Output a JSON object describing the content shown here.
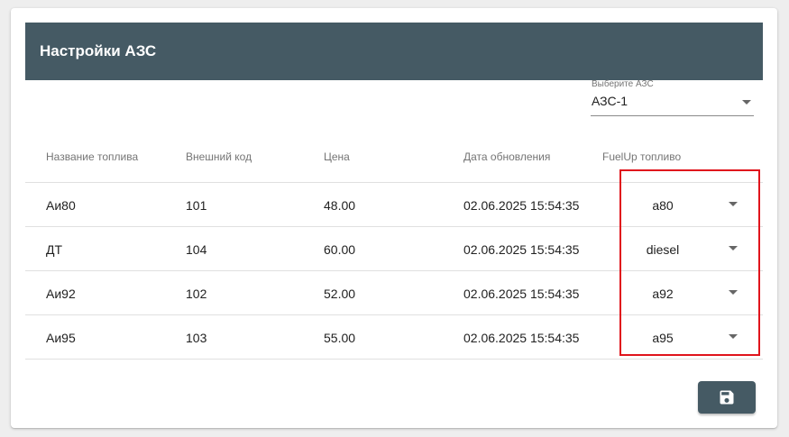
{
  "header": {
    "title": "Настройки АЗС"
  },
  "station_select": {
    "label": "Выберите АЗС",
    "value": "АЗС-1"
  },
  "table": {
    "columns": [
      "Название топлива",
      "Внешний код",
      "Цена",
      "Дата обновления",
      "FuelUp топливо"
    ],
    "rows": [
      {
        "name": "Аи80",
        "code": "101",
        "price": "48.00",
        "updated": "02.06.2025 15:54:35",
        "fuelup": "a80"
      },
      {
        "name": "ДТ",
        "code": "104",
        "price": "60.00",
        "updated": "02.06.2025 15:54:35",
        "fuelup": "diesel"
      },
      {
        "name": "Аи92",
        "code": "102",
        "price": "52.00",
        "updated": "02.06.2025 15:54:35",
        "fuelup": "a92"
      },
      {
        "name": "Аи95",
        "code": "103",
        "price": "55.00",
        "updated": "02.06.2025 15:54:35",
        "fuelup": "a95"
      }
    ]
  },
  "colors": {
    "header_bg": "#455a64",
    "highlight": "#e0141c",
    "button_bg": "#455a64"
  },
  "icons": {
    "save": "floppy-disk-icon",
    "dropdown": "caret-down-icon"
  }
}
